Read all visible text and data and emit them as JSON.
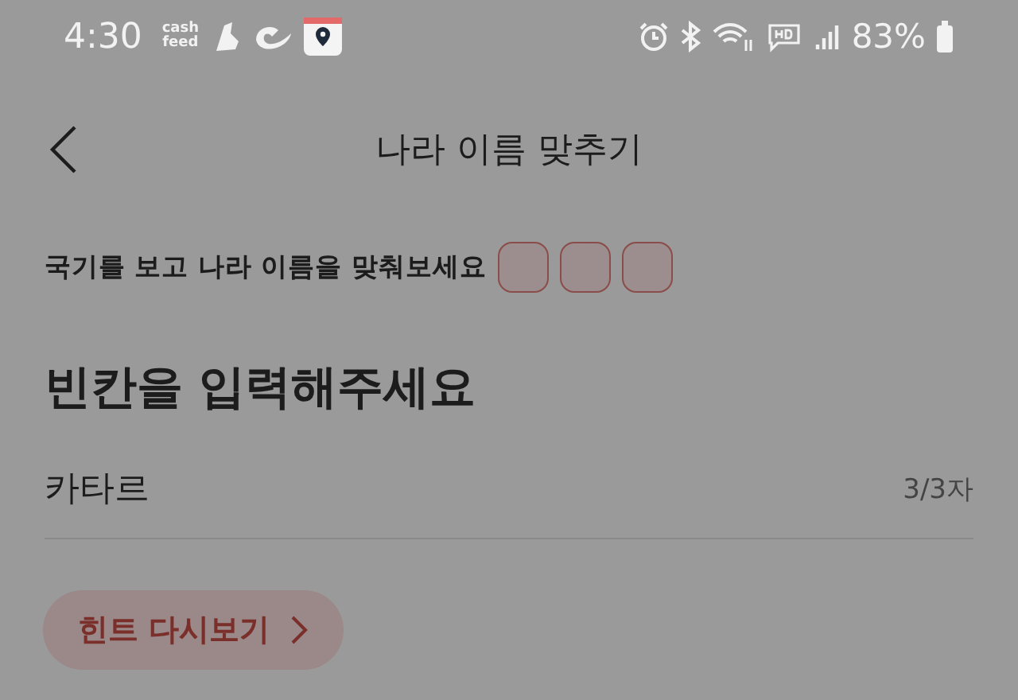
{
  "status_bar": {
    "time": "4:30",
    "app_label": "cash feed",
    "battery": "83%"
  },
  "header": {
    "title": "나라 이름 맞추기"
  },
  "instruction": "국기를 보고 나라 이름을 맞춰보세요",
  "slots": [
    {
      "filled": false
    },
    {
      "filled": false
    },
    {
      "filled": false
    }
  ],
  "heading": "빈칸을 입력해주세요",
  "answer_field": {
    "value": "카타르",
    "counter": "3/3자"
  },
  "hint_button": {
    "label": "힌트 다시보기"
  }
}
